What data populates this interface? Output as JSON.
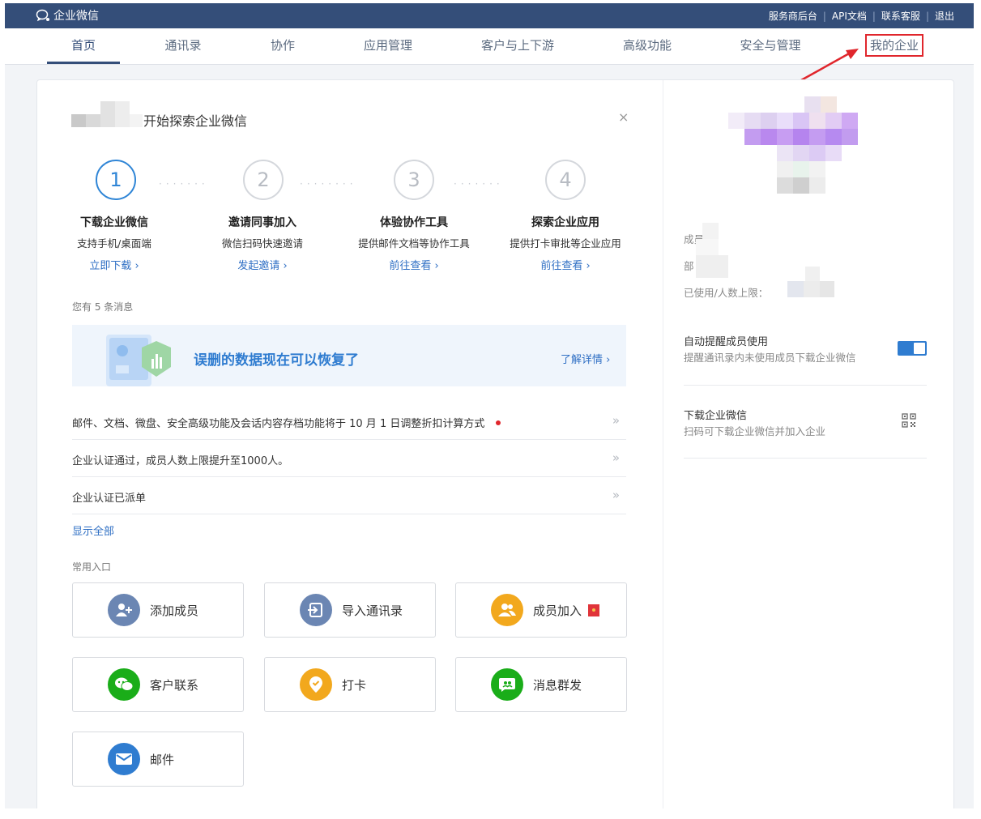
{
  "topbar": {
    "logo_text": "企业微信",
    "links": [
      "服务商后台",
      "API文档",
      "联系客服",
      "退出"
    ],
    "separator": "|"
  },
  "nav": {
    "items": [
      "首页",
      "通讯录",
      "协作",
      "应用管理",
      "客户与上下游",
      "高级功能",
      "安全与管理",
      "我的企业"
    ],
    "active": "首页",
    "highlighted": "我的企业"
  },
  "guide": {
    "title": "开始探索企业微信",
    "close": "×",
    "steps": [
      {
        "num": "1",
        "title": "下载企业微信",
        "desc": "支持手机/桌面端",
        "link": "立即下载 ›"
      },
      {
        "num": "2",
        "title": "邀请同事加入",
        "desc": "微信扫码快速邀请",
        "link": "发起邀请 ›"
      },
      {
        "num": "3",
        "title": "体验协作工具",
        "desc": "提供邮件文档等协作工具",
        "link": "前往查看 ›"
      },
      {
        "num": "4",
        "title": "探索企业应用",
        "desc": "提供打卡审批等企业应用",
        "link": "前往查看 ›"
      }
    ]
  },
  "messages": {
    "count_text": "您有 5 条消息",
    "banner": {
      "text": "误删的数据现在可以恢复了",
      "link": "了解详情 ›"
    },
    "items": [
      {
        "text": "邮件、文档、微盘、安全高级功能及会话内容存档功能将于 10 月 1 日调整折扣计算方式",
        "unread": true
      },
      {
        "text": "企业认证通过，成员人数上限提升至1000人。",
        "unread": false
      },
      {
        "text": "企业认证已派单",
        "unread": false
      }
    ],
    "chevron": "»",
    "show_all": "显示全部"
  },
  "common": {
    "label": "常用入口",
    "tiles": [
      {
        "label": "添加成员",
        "icon": "add-user-icon",
        "color": "#6b86b3"
      },
      {
        "label": "导入通讯录",
        "icon": "import-icon",
        "color": "#6b86b3"
      },
      {
        "label": "成员加入",
        "icon": "members-icon",
        "color": "#f2a81d",
        "badge": true
      },
      {
        "label": "客户联系",
        "icon": "wechat-icon",
        "color": "#1aad19"
      },
      {
        "label": "打卡",
        "icon": "location-icon",
        "color": "#f2a81d"
      },
      {
        "label": "消息群发",
        "icon": "broadcast-icon",
        "color": "#1aad19"
      },
      {
        "label": "邮件",
        "icon": "mail-icon",
        "color": "#2f7cd0"
      }
    ]
  },
  "sidebar": {
    "members_label": "成员：",
    "dept_label": "部",
    "quota_label": "已使用/人数上限：",
    "auto_remind_title": "自动提醒成员使用",
    "auto_remind_desc": "提醒通讯录内未使用成员下载企业微信",
    "auto_remind_on": true,
    "download_title": "下载企业微信",
    "download_desc": "扫码可下载企业微信并加入企业"
  },
  "colors": {
    "topbar": "#344e79",
    "accent": "#2f7cd0",
    "highlight": "#e0262c"
  }
}
